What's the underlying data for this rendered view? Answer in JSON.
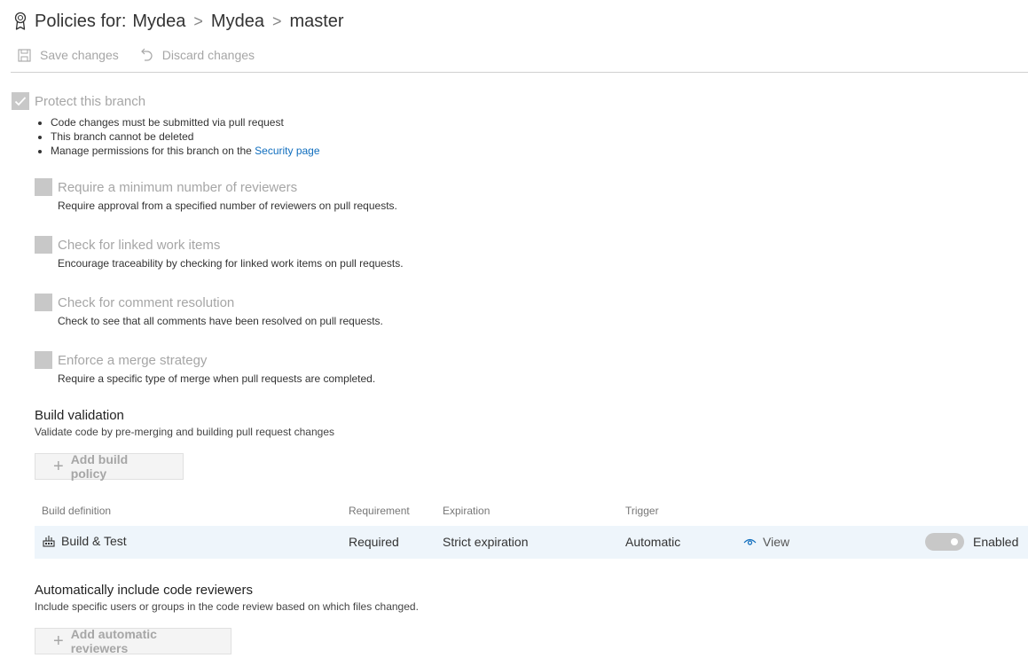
{
  "header": {
    "title_prefix": "Policies for:",
    "breadcrumbs": [
      "Mydea",
      "Mydea",
      "master"
    ],
    "separator": ">"
  },
  "toolbar": {
    "save_label": "Save changes",
    "discard_label": "Discard changes"
  },
  "protect": {
    "label": "Protect this branch",
    "checked": true,
    "bullets": [
      "Code changes must be submitted via pull request",
      "This branch cannot be deleted"
    ],
    "permissions_text": "Manage permissions for this branch on the",
    "security_link": "Security page"
  },
  "options": [
    {
      "label": "Require a minimum number of reviewers",
      "desc": "Require approval from a specified number of reviewers on pull requests.",
      "checked": false
    },
    {
      "label": "Check for linked work items",
      "desc": "Encourage traceability by checking for linked work items on pull requests.",
      "checked": false
    },
    {
      "label": "Check for comment resolution",
      "desc": "Check to see that all comments have been resolved on pull requests.",
      "checked": false
    },
    {
      "label": "Enforce a merge strategy",
      "desc": "Require a specific type of merge when pull requests are completed.",
      "checked": false
    }
  ],
  "build_validation": {
    "title": "Build validation",
    "desc": "Validate code by pre-merging and building pull request changes",
    "add_label": "Add build policy",
    "columns": [
      "Build definition",
      "Requirement",
      "Expiration",
      "Trigger"
    ],
    "rows": [
      {
        "name": "Build & Test",
        "requirement": "Required",
        "expiration": "Strict expiration",
        "trigger": "Automatic",
        "view": "View",
        "status": "Enabled",
        "enabled": true
      }
    ]
  },
  "reviewers": {
    "title": "Automatically include code reviewers",
    "desc": "Include specific users or groups in the code review based on which files changed.",
    "add_label": "Add automatic reviewers"
  },
  "colors": {
    "disabled_text": "#a6a6a6",
    "checkbox_gray": "#c8c8c8",
    "link": "#106ebe",
    "row_highlight": "#eef5fb"
  },
  "icons": {
    "title": "policy-badge-icon",
    "save": "save-icon",
    "discard": "undo-icon",
    "build": "build-pipeline-icon",
    "view": "eye-icon"
  }
}
